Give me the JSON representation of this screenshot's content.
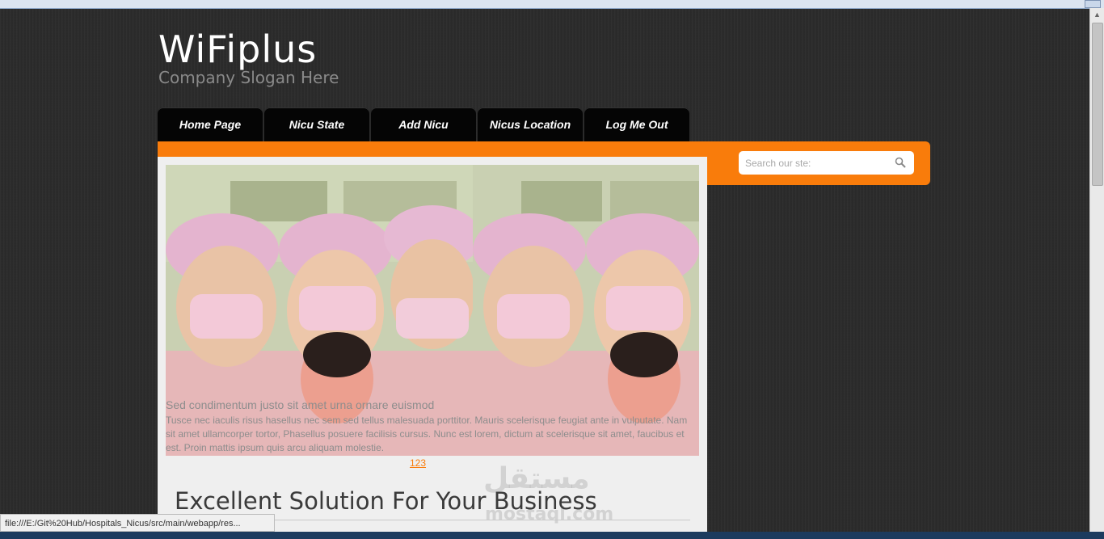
{
  "header": {
    "logo": "WiFiplus",
    "slogan": "Company Slogan Here"
  },
  "nav": {
    "items": [
      "Home Page",
      "Nicu State",
      "Add Nicu",
      "Nicus Location",
      "Log Me Out"
    ]
  },
  "search": {
    "placeholder": "Search our ste:",
    "icon": "magnifier-icon"
  },
  "slider": {
    "caption_title": "Sed condimentum justo sit amet urna ornare euismod",
    "caption_text": "Tusce nec iaculis risus hasellus nec sem sed tellus malesuada porttitor. Mauris scelerisque feugiat ante in vulputate. Nam sit amet ullamcorper tortor, Phasellus posuere facilisis cursus. Nunc est lorem, dictum at scelerisque sit amet, faucibus et est. Proin mattis ipsum quis arcu aliquam molestie.",
    "pager": "123"
  },
  "main": {
    "heading": "Excellent Solution For Your Business"
  },
  "watermark": {
    "arabic": "مستقل",
    "latin": "mostaql.com"
  },
  "statusbar": {
    "url": "file:///E:/Git%20Hub/Hospitals_Nicus/src/main/webapp/res..."
  },
  "colors": {
    "accent": "#f97c0b",
    "background": "#2b2b2b",
    "nav": "#050505",
    "content": "#efefef"
  }
}
